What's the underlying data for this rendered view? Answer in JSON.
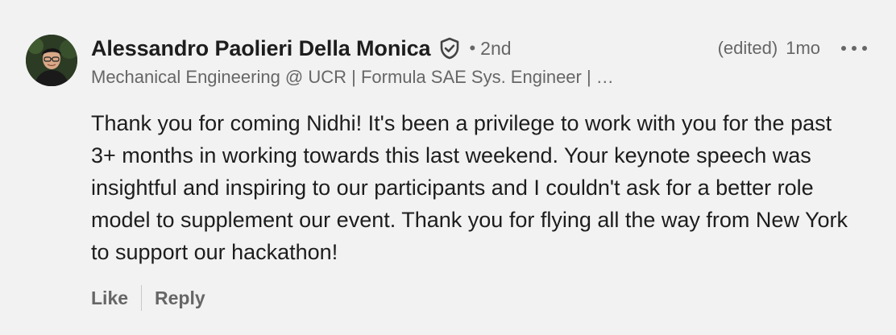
{
  "comment": {
    "author_name": "Alessandro Paolieri Della Monica",
    "verified_icon": "shield-check-icon",
    "separator": "•",
    "degree": "2nd",
    "edited_label": "(edited)",
    "age": "1mo",
    "more_icon": "more-horizontal-icon",
    "headline": "Mechanical Engineering @ UCR | Formula SAE Sys. Engineer | …",
    "body": "Thank you for coming Nidhi! It's been a privilege to work with you for the past 3+ months in working towards this last weekend. Your keynote speech was insightful and inspiring to our participants and I couldn't ask for a better role model to supplement our event. Thank you for flying all the way from New York to support our hackathon!",
    "actions": {
      "like_label": "Like",
      "reply_label": "Reply"
    }
  },
  "colors": {
    "background": "#f2f2f2",
    "text_primary": "#1d1d1d",
    "text_secondary": "#666666"
  }
}
